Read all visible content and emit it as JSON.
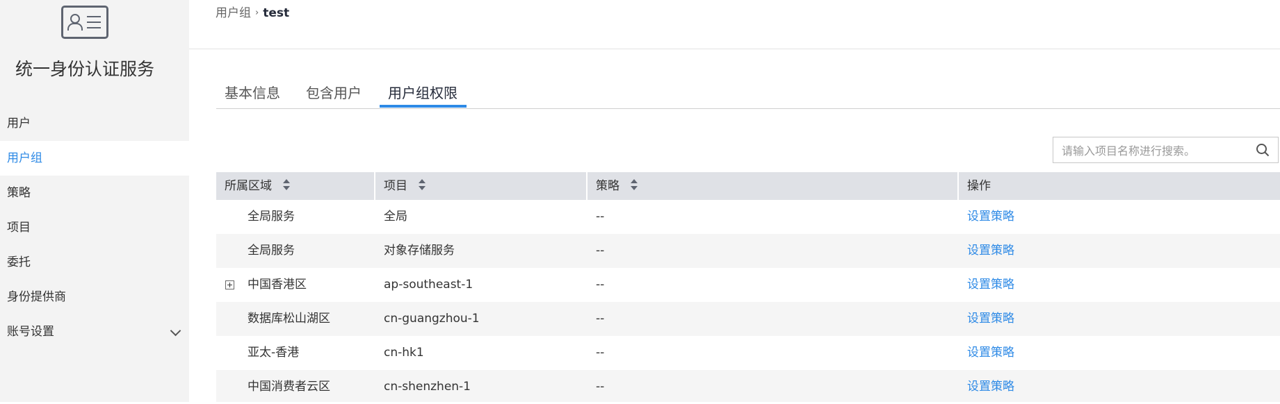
{
  "sidebar": {
    "logo_icon": "id-card-icon",
    "service_title": "统一身份认证服务",
    "items": [
      {
        "label": "用户",
        "active": false
      },
      {
        "label": "用户组",
        "active": true
      },
      {
        "label": "策略",
        "active": false
      },
      {
        "label": "项目",
        "active": false
      },
      {
        "label": "委托",
        "active": false
      },
      {
        "label": "身份提供商",
        "active": false
      },
      {
        "label": "账号设置",
        "active": false,
        "icon": "chevron-down-icon"
      }
    ]
  },
  "breadcrumb": {
    "parent": "用户组",
    "separator_icon": "chevron-right-icon",
    "current": "test"
  },
  "tabs": [
    {
      "label": "基本信息",
      "active": false
    },
    {
      "label": "包含用户",
      "active": false
    },
    {
      "label": "用户组权限",
      "active": true
    }
  ],
  "search": {
    "placeholder": "请输入项目名称进行搜索。",
    "value": "",
    "icon": "search-icon"
  },
  "table": {
    "columns": [
      {
        "label": "所属区域",
        "sortable": true
      },
      {
        "label": "项目",
        "sortable": true
      },
      {
        "label": "策略",
        "sortable": true
      },
      {
        "label": "操作",
        "sortable": false
      }
    ],
    "rows": [
      {
        "region": "全局服务",
        "project": "全局",
        "policy": "--",
        "action": "设置策略",
        "expandable": false
      },
      {
        "region": "全局服务",
        "project": "对象存储服务",
        "policy": "--",
        "action": "设置策略",
        "expandable": false
      },
      {
        "region": "中国香港区",
        "project": "ap-southeast-1",
        "policy": "--",
        "action": "设置策略",
        "expandable": true
      },
      {
        "region": "数据库松山湖区",
        "project": "cn-guangzhou-1",
        "policy": "--",
        "action": "设置策略",
        "expandable": false
      },
      {
        "region": "亚太-香港",
        "project": "cn-hk1",
        "policy": "--",
        "action": "设置策略",
        "expandable": false
      },
      {
        "region": "中国消费者云区",
        "project": "cn-shenzhen-1",
        "policy": "--",
        "action": "设置策略",
        "expandable": false
      }
    ]
  },
  "colors": {
    "accent": "#2e8ae6",
    "sidebar_bg": "#f3f3f3",
    "table_header_bg": "#dfe1e6",
    "row_alt_bg": "#f5f5f5"
  }
}
